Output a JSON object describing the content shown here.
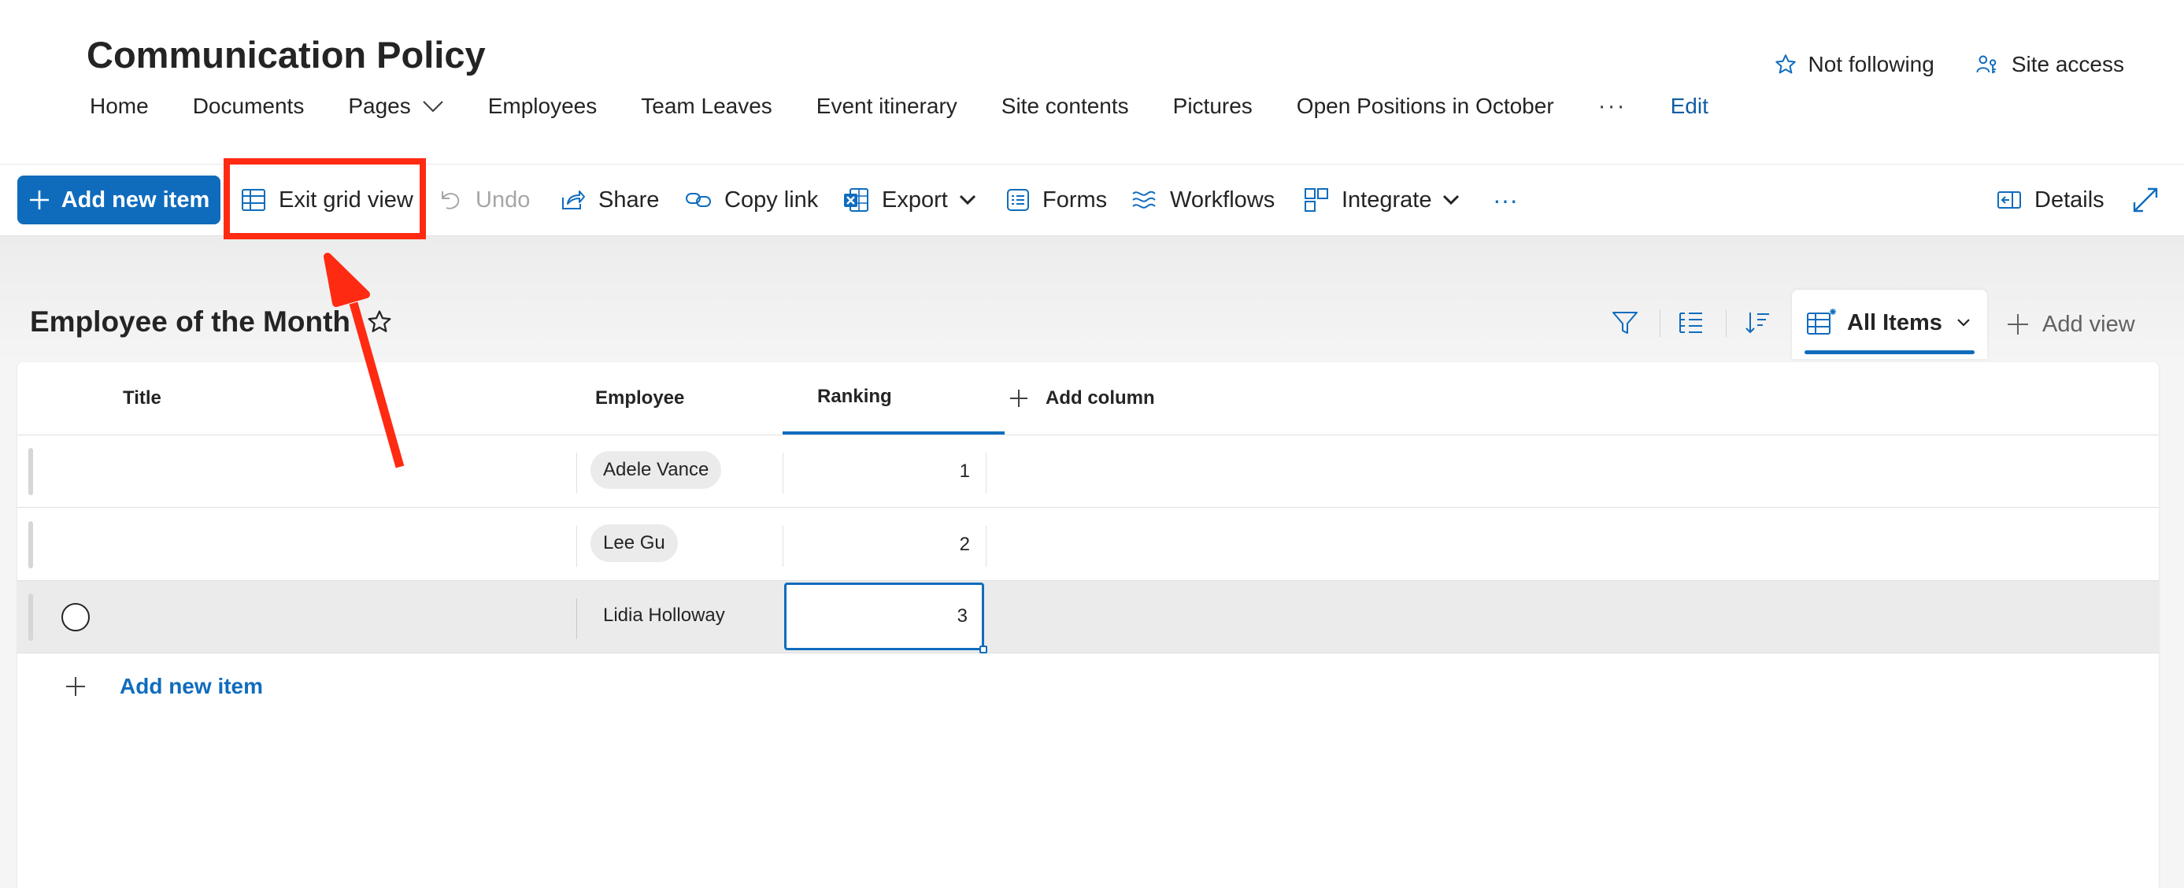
{
  "site": {
    "title": "Communication Policy",
    "nav": [
      {
        "label": "Home"
      },
      {
        "label": "Documents"
      },
      {
        "label": "Pages",
        "has_dropdown": true
      },
      {
        "label": "Employees"
      },
      {
        "label": "Team Leaves"
      },
      {
        "label": "Event itinerary"
      },
      {
        "label": "Site contents"
      },
      {
        "label": "Pictures"
      },
      {
        "label": "Open Positions in October"
      }
    ],
    "nav_more": "···",
    "edit_label": "Edit",
    "follow_label": "Not following",
    "site_access_label": "Site access"
  },
  "commands": {
    "add_new_item": "Add new item",
    "exit_grid_view": "Exit grid view",
    "undo": "Undo",
    "share": "Share",
    "copy_link": "Copy link",
    "export": "Export",
    "forms": "Forms",
    "workflows": "Workflows",
    "integrate": "Integrate",
    "more": "···",
    "details": "Details"
  },
  "list": {
    "title": "Employee of the Month",
    "view_name": "All Items",
    "add_view": "Add view",
    "columns": {
      "title": "Title",
      "employee": "Employee",
      "ranking": "Ranking",
      "add_column": "Add column"
    },
    "rows": [
      {
        "title": "",
        "employee": "Adele Vance",
        "ranking": "1"
      },
      {
        "title": "",
        "employee": "Lee Gu",
        "ranking": "2"
      },
      {
        "title": "",
        "employee": "Lidia Holloway",
        "ranking": "3"
      }
    ],
    "add_new_item": "Add new item"
  },
  "colors": {
    "accent": "#0f6cbd",
    "link": "#115ea3",
    "annotation": "#ff2a12",
    "selected_row": "#ebebeb"
  }
}
